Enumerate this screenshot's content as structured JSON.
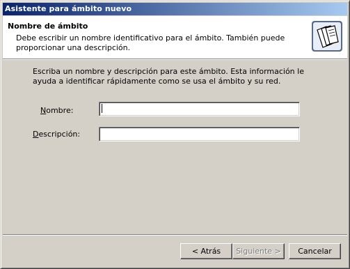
{
  "window": {
    "title": "Asistente para ámbito nuevo"
  },
  "header": {
    "title": "Nombre de ámbito",
    "description": "Debe escribir un nombre identificativo para el ámbito. También puede proporcionar una descripción.",
    "icon": "folder-documents-icon"
  },
  "body": {
    "intro": "Escriba un nombre y descripción para este ámbito. Esta información le ayuda a identificar rápidamente como se usa el ámbito y su red.",
    "name_field": {
      "label": "Nombre:",
      "value": "",
      "accelerator": "N"
    },
    "description_field": {
      "label": "Descripción:",
      "value": "",
      "accelerator": "D"
    }
  },
  "buttons": {
    "back": "< Atrás",
    "next": "Siguiente >",
    "cancel": "Cancelar"
  },
  "colors": {
    "titlebar_start": "#0a246a",
    "titlebar_end": "#a6caf0",
    "face": "#d4d0c8"
  }
}
